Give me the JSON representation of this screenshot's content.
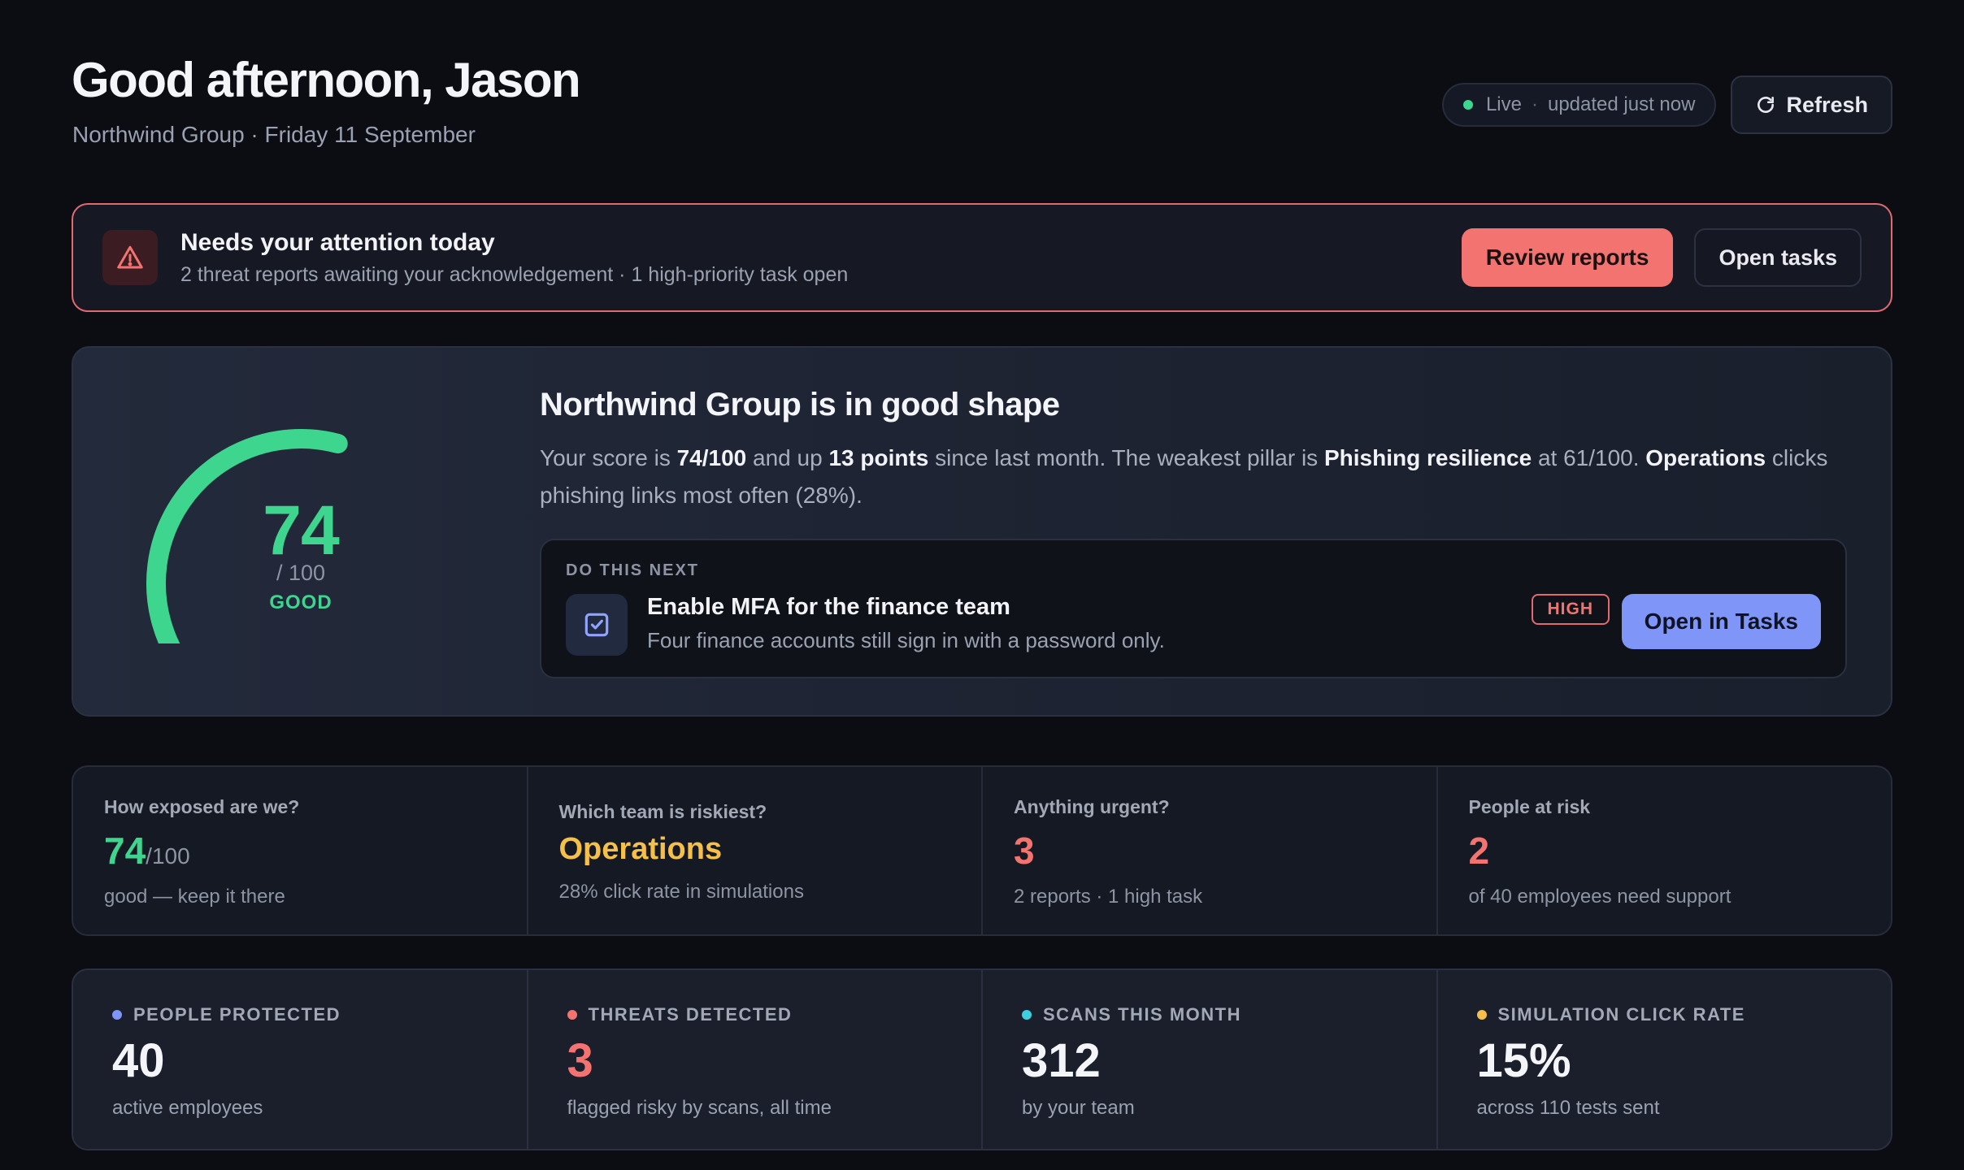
{
  "header": {
    "greeting": "Good afternoon, Jason",
    "subline": "Northwind Group · Friday 11 September",
    "live_label": "Live",
    "live_separator": "·",
    "live_status": "updated just now",
    "refresh_label": "Refresh"
  },
  "alert": {
    "title": "Needs your attention today",
    "subtitle": "2 threat reports awaiting your acknowledgement · 1 high-priority task open",
    "primary_label": "Review reports",
    "secondary_label": "Open tasks"
  },
  "score": {
    "value": 74,
    "value_text": "74",
    "max_text": "/ 100",
    "rating": "GOOD",
    "fraction": 0.74,
    "title": "Northwind Group is in good shape",
    "desc": {
      "p1": "Your score is ",
      "b1": "74/100",
      "p2": " and up ",
      "b2": "13 points",
      "p3": " since last month. The weakest pillar is ",
      "b3": "Phishing resilience",
      "p4": " at 61/100. ",
      "b4": "Operations",
      "p5": " clicks phishing links most often (28%)."
    },
    "next": {
      "kicker": "DO THIS NEXT",
      "title": "Enable MFA for the finance team",
      "subtitle": "Four finance accounts still sign in with a password only.",
      "priority": "HIGH",
      "action_label": "Open in Tasks"
    }
  },
  "questions": [
    {
      "label": "How exposed are we?",
      "value": "74",
      "suffix": "/100",
      "note": "good — keep it there",
      "color": "#3ed68f"
    },
    {
      "label": "Which team is riskiest?",
      "value": "Operations",
      "suffix": "",
      "note": "28% click rate in simulations",
      "color": "#f5c04a"
    },
    {
      "label": "Anything urgent?",
      "value": "3",
      "suffix": "",
      "note": "2 reports · 1 high task",
      "color": "#f37370"
    },
    {
      "label": "People at risk",
      "value": "2",
      "suffix": "",
      "note": "of 40 employees need support",
      "color": "#f37370"
    }
  ],
  "stats": [
    {
      "label": "PEOPLE PROTECTED",
      "value": "40",
      "note": "active employees",
      "dot_color": "#7f95f7",
      "value_color": "#f4f5f8"
    },
    {
      "label": "THREATS DETECTED",
      "value": "3",
      "note": "flagged risky by scans, all time",
      "dot_color": "#f37370",
      "value_color": "#f37370"
    },
    {
      "label": "SCANS THIS MONTH",
      "value": "312",
      "note": "by your team",
      "dot_color": "#3fd0e0",
      "value_color": "#f4f5f8"
    },
    {
      "label": "SIMULATION CLICK RATE",
      "value": "15%",
      "note": "across 110 tests sent",
      "dot_color": "#f5c04a",
      "value_color": "#f4f5f8"
    }
  ],
  "colors": {
    "accent_green": "#3ed68f",
    "accent_red": "#f37370",
    "accent_blue": "#7f95f7",
    "accent_yellow": "#f5c04a"
  },
  "icons": {
    "alert": "warning-triangle-icon",
    "refresh": "refresh-icon",
    "task": "checkbox-icon"
  }
}
